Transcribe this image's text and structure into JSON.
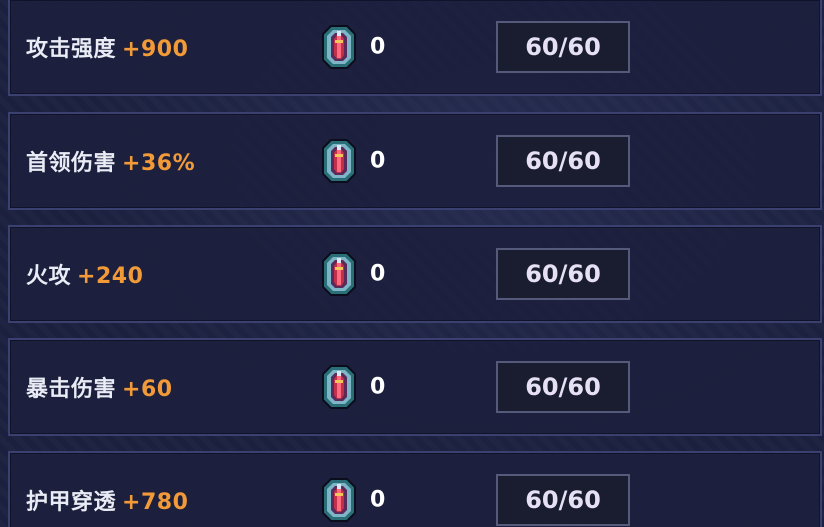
{
  "upgrades": [
    {
      "name": "攻击强度",
      "bonus": "+900",
      "gems": "0",
      "level": "60/60"
    },
    {
      "name": "首领伤害",
      "bonus": "+36%",
      "gems": "0",
      "level": "60/60"
    },
    {
      "name": "火攻",
      "bonus": "+240",
      "gems": "0",
      "level": "60/60"
    },
    {
      "name": "暴击伤害",
      "bonus": "+60",
      "gems": "0",
      "level": "60/60"
    },
    {
      "name": "护甲穿透",
      "bonus": "+780",
      "gems": "0",
      "level": "60/60"
    }
  ],
  "colors": {
    "bonus": "#f29a38",
    "name": "#e9ecf5",
    "panel_border": "#3a4170",
    "background": "#1c2140"
  },
  "icons": {
    "gem": "crystal-gem-icon"
  }
}
